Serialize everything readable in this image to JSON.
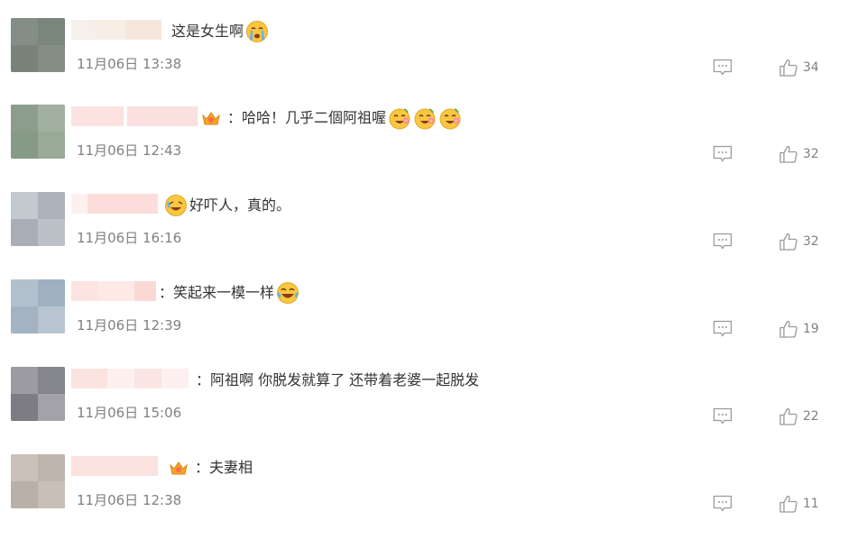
{
  "comments": [
    {
      "text": "这是女生啊",
      "emoji": "crying-face-icon",
      "time": "11月06日 13:38",
      "likes": "34"
    },
    {
      "text": "：哈哈！几乎二個阿祖喔",
      "emoji": "laughing-flower-face-icon",
      "time": "11月06日 12:43",
      "likes": "32"
    },
    {
      "text": "好吓人，真的。",
      "emoji": "sweat-laugh-face-icon",
      "time": "11月06日 16:16",
      "likes": "32"
    },
    {
      "text": "：笑起来一模一样",
      "emoji": "tears-of-joy-icon",
      "time": "11月06日 12:39",
      "likes": "19"
    },
    {
      "text": "：阿祖啊 你脱发就算了 还带着老婆一起脱发",
      "time": "11月06日 15:06",
      "likes": "22"
    },
    {
      "text": "：夫妻相",
      "time": "11月06日 12:38",
      "likes": "11"
    }
  ],
  "colors": {
    "text": "#333333",
    "meta": "#808080",
    "icon": "#9a9a9a",
    "emoji_yellow": "#f9c642",
    "badge_gold": "#f5a623"
  }
}
